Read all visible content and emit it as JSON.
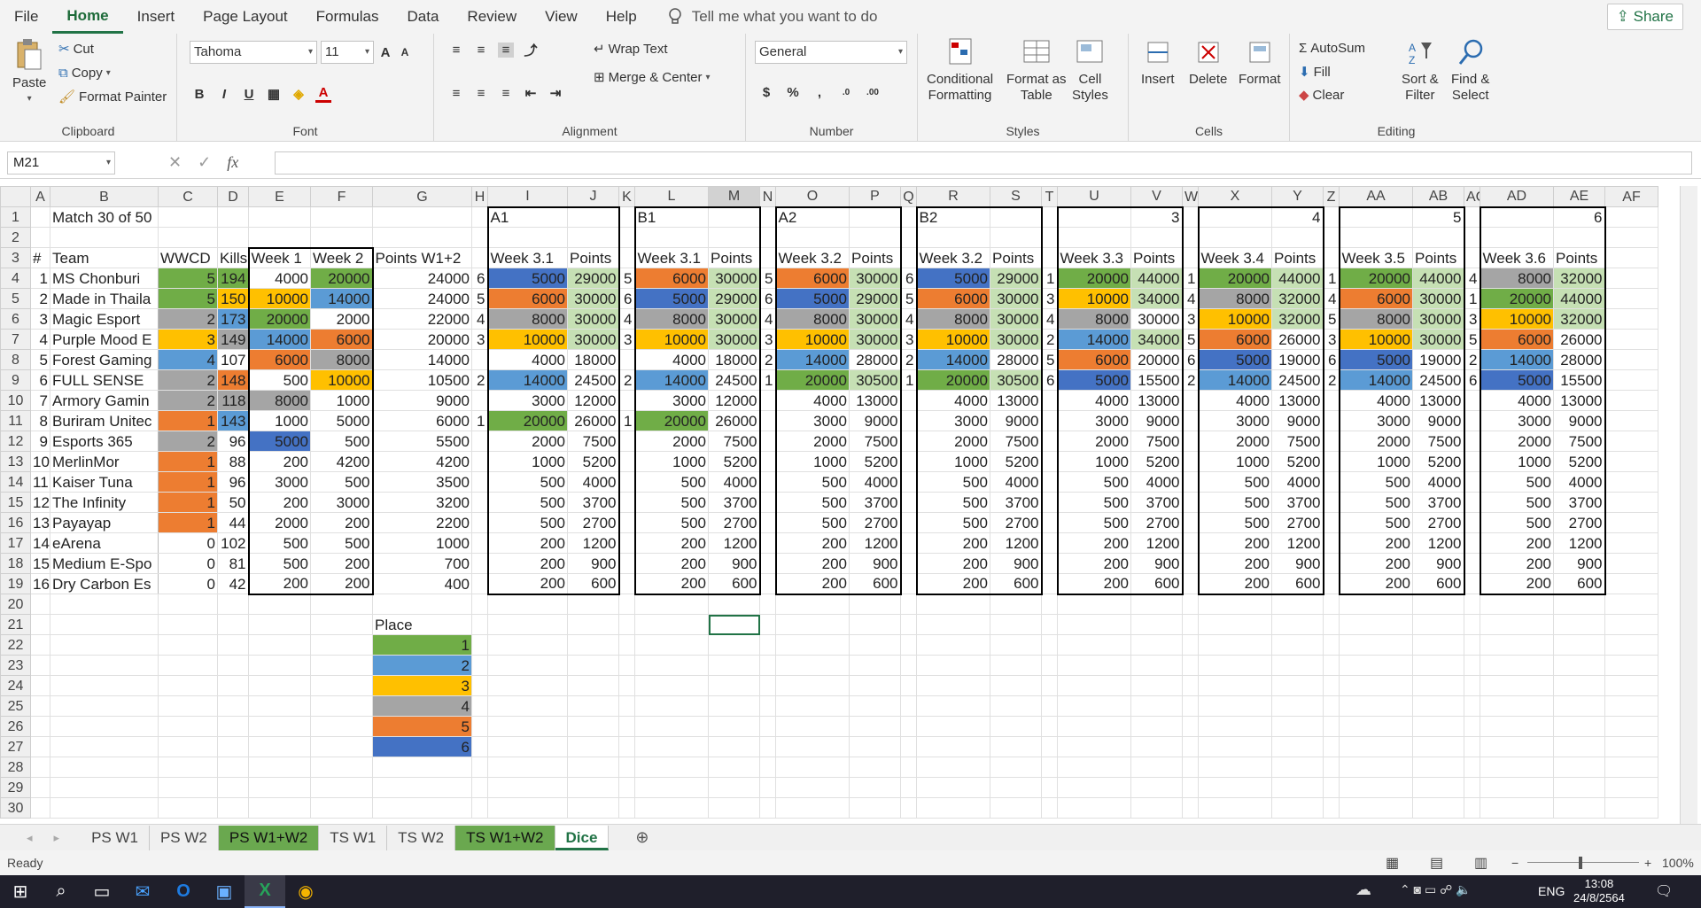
{
  "menu": {
    "tabs": [
      "File",
      "Home",
      "Insert",
      "Page Layout",
      "Formulas",
      "Data",
      "Review",
      "View",
      "Help"
    ],
    "active": "Home",
    "tellme": "Tell me what you want to do",
    "share": "Share"
  },
  "ribbon": {
    "clipboard": {
      "label": "Clipboard",
      "paste": "Paste",
      "cut": "Cut",
      "copy": "Copy",
      "format_painter": "Format Painter"
    },
    "font": {
      "label": "Font",
      "name": "Tahoma",
      "size": "11"
    },
    "alignment": {
      "label": "Alignment",
      "wrap": "Wrap Text",
      "merge": "Merge & Center"
    },
    "number": {
      "label": "Number",
      "format": "General"
    },
    "styles": {
      "label": "Styles",
      "cond": "Conditional",
      "cond2": "Formatting",
      "fmt_table": "Format as",
      "fmt_table2": "Table",
      "cell_styles": "Cell",
      "cell_styles2": "Styles"
    },
    "cells": {
      "label": "Cells",
      "insert": "Insert",
      "delete": "Delete",
      "format": "Format"
    },
    "editing": {
      "label": "Editing",
      "autosum": "AutoSum",
      "fill": "Fill",
      "clear": "Clear",
      "sort": "Sort &",
      "sort2": "Filter",
      "find": "Find &",
      "find2": "Select"
    }
  },
  "formula_bar": {
    "name_box": "M21",
    "fx": "fx",
    "content": ""
  },
  "columns": [
    "A",
    "B",
    "C",
    "D",
    "E",
    "F",
    "G",
    "H",
    "I",
    "J",
    "K",
    "L",
    "M",
    "N",
    "O",
    "P",
    "Q",
    "R",
    "S",
    "T",
    "U",
    "V",
    "W",
    "X",
    "Y",
    "Z",
    "AA",
    "AB",
    "AC",
    "AD",
    "AE",
    "AF"
  ],
  "place_colors": {
    "1": "#70ad47",
    "2": "#5b9bd5",
    "3": "#ffc000",
    "4": "#a5a5a5",
    "5": "#ed7d31",
    "6": "#4472c4",
    "light": "#c6e0b4"
  },
  "rows": [
    {
      "n": "1",
      "cells": {
        "B": "Match 30 of 50",
        "I": "A1",
        "L": "B1",
        "O": "A2",
        "R": "B2",
        "V": "3",
        "Y": "4",
        "AB": "5",
        "AE": "6"
      }
    },
    {
      "n": "2",
      "cells": {}
    },
    {
      "n": "3",
      "cells": {
        "A": "#",
        "B": "Team",
        "C": "WWCD",
        "D": "Kills",
        "E": "Week 1",
        "F": "Week 2",
        "G": "Points W1+2",
        "I": "Week 3.1",
        "J": "Points",
        "L": "Week 3.1",
        "M": "Points",
        "O": "Week 3.2",
        "P": "Points",
        "R": "Week 3.2",
        "S": "Points",
        "U": "Week 3.3",
        "V": "Points",
        "X": "Week 3.4",
        "Y": "Points",
        "AA": "Week 3.5",
        "AB": "Points",
        "AD": "Week 3.6",
        "AE": "Points"
      }
    },
    {
      "n": "4",
      "cells": {
        "A": "1",
        "B": "MS Chonburi",
        "C": "5",
        "D": "194",
        "E": "4000",
        "F": "20000",
        "G": "24000",
        "H": "6",
        "I": "5000",
        "J": "29000",
        "K": "5",
        "L": "6000",
        "M": "30000",
        "N": "5",
        "O": "6000",
        "P": "30000",
        "Q": "6",
        "R": "5000",
        "S": "29000",
        "T": "1",
        "U": "20000",
        "V": "44000",
        "W": "1",
        "X": "20000",
        "Y": "44000",
        "Z": "1",
        "AA": "20000",
        "AB": "44000",
        "AC": "4",
        "AD": "8000",
        "AE": "32000"
      }
    },
    {
      "n": "5",
      "cells": {
        "A": "2",
        "B": "Made in Thaila",
        "C": "5",
        "D": "150",
        "E": "10000",
        "F": "14000",
        "G": "24000",
        "H": "5",
        "I": "6000",
        "J": "30000",
        "K": "6",
        "L": "5000",
        "M": "29000",
        "N": "6",
        "O": "5000",
        "P": "29000",
        "Q": "5",
        "R": "6000",
        "S": "30000",
        "T": "3",
        "U": "10000",
        "V": "34000",
        "W": "4",
        "X": "8000",
        "Y": "32000",
        "Z": "4",
        "AA": "6000",
        "AB": "30000",
        "AC": "1",
        "AD": "20000",
        "AE": "44000"
      }
    },
    {
      "n": "6",
      "cells": {
        "A": "3",
        "B": "Magic Esport",
        "C": "2",
        "D": "173",
        "E": "20000",
        "F": "2000",
        "G": "22000",
        "H": "4",
        "I": "8000",
        "J": "30000",
        "K": "4",
        "L": "8000",
        "M": "30000",
        "N": "4",
        "O": "8000",
        "P": "30000",
        "Q": "4",
        "R": "8000",
        "S": "30000",
        "T": "4",
        "U": "8000",
        "V": "30000",
        "W": "3",
        "X": "10000",
        "Y": "32000",
        "Z": "5",
        "AA": "8000",
        "AB": "30000",
        "AC": "3",
        "AD": "10000",
        "AE": "32000"
      }
    },
    {
      "n": "7",
      "cells": {
        "A": "4",
        "B": "Purple Mood E",
        "C": "3",
        "D": "149",
        "E": "14000",
        "F": "6000",
        "G": "20000",
        "H": "3",
        "I": "10000",
        "J": "30000",
        "K": "3",
        "L": "10000",
        "M": "30000",
        "N": "3",
        "O": "10000",
        "P": "30000",
        "Q": "3",
        "R": "10000",
        "S": "30000",
        "T": "2",
        "U": "14000",
        "V": "34000",
        "W": "5",
        "X": "6000",
        "Y": "26000",
        "Z": "3",
        "AA": "10000",
        "AB": "30000",
        "AC": "5",
        "AD": "6000",
        "AE": "26000"
      }
    },
    {
      "n": "8",
      "cells": {
        "A": "5",
        "B": "Forest Gaming",
        "C": "4",
        "D": "107",
        "E": "6000",
        "F": "8000",
        "G": "14000",
        "I": "4000",
        "J": "18000",
        "L": "4000",
        "M": "18000",
        "N": "2",
        "O": "14000",
        "P": "28000",
        "Q": "2",
        "R": "14000",
        "S": "28000",
        "T": "5",
        "U": "6000",
        "V": "20000",
        "W": "6",
        "X": "5000",
        "Y": "19000",
        "Z": "6",
        "AA": "5000",
        "AB": "19000",
        "AC": "2",
        "AD": "14000",
        "AE": "28000"
      }
    },
    {
      "n": "9",
      "cells": {
        "A": "6",
        "B": "FULL SENSE",
        "C": "2",
        "D": "148",
        "E": "500",
        "F": "10000",
        "G": "10500",
        "H": "2",
        "I": "14000",
        "J": "24500",
        "K": "2",
        "L": "14000",
        "M": "24500",
        "N": "1",
        "O": "20000",
        "P": "30500",
        "Q": "1",
        "R": "20000",
        "S": "30500",
        "T": "6",
        "U": "5000",
        "V": "15500",
        "W": "2",
        "X": "14000",
        "Y": "24500",
        "Z": "2",
        "AA": "14000",
        "AB": "24500",
        "AC": "6",
        "AD": "5000",
        "AE": "15500"
      }
    },
    {
      "n": "10",
      "cells": {
        "A": "7",
        "B": "Armory Gamin",
        "C": "2",
        "D": "118",
        "E": "8000",
        "F": "1000",
        "G": "9000",
        "I": "3000",
        "J": "12000",
        "L": "3000",
        "M": "12000",
        "O": "4000",
        "P": "13000",
        "R": "4000",
        "S": "13000",
        "U": "4000",
        "V": "13000",
        "X": "4000",
        "Y": "13000",
        "AA": "4000",
        "AB": "13000",
        "AD": "4000",
        "AE": "13000"
      }
    },
    {
      "n": "11",
      "cells": {
        "A": "8",
        "B": "Buriram Unitec",
        "C": "1",
        "D": "143",
        "E": "1000",
        "F": "5000",
        "G": "6000",
        "H": "1",
        "I": "20000",
        "J": "26000",
        "K": "1",
        "L": "20000",
        "M": "26000",
        "O": "3000",
        "P": "9000",
        "R": "3000",
        "S": "9000",
        "U": "3000",
        "V": "9000",
        "X": "3000",
        "Y": "9000",
        "AA": "3000",
        "AB": "9000",
        "AD": "3000",
        "AE": "9000"
      }
    },
    {
      "n": "12",
      "cells": {
        "A": "9",
        "B": "Esports 365",
        "C": "2",
        "D": "96",
        "E": "5000",
        "F": "500",
        "G": "5500",
        "I": "2000",
        "J": "7500",
        "L": "2000",
        "M": "7500",
        "O": "2000",
        "P": "7500",
        "R": "2000",
        "S": "7500",
        "U": "2000",
        "V": "7500",
        "X": "2000",
        "Y": "7500",
        "AA": "2000",
        "AB": "7500",
        "AD": "2000",
        "AE": "7500"
      }
    },
    {
      "n": "13",
      "cells": {
        "A": "10",
        "B": "MerlinMor",
        "C": "1",
        "D": "88",
        "E": "200",
        "F": "4200",
        "G": "4200",
        "I": "1000",
        "J": "5200",
        "L": "1000",
        "M": "5200",
        "O": "1000",
        "P": "5200",
        "R": "1000",
        "S": "5200",
        "U": "1000",
        "V": "5200",
        "X": "1000",
        "Y": "5200",
        "AA": "1000",
        "AB": "5200",
        "AD": "1000",
        "AE": "5200"
      }
    },
    {
      "n": "14",
      "cells": {
        "A": "11",
        "B": "Kaiser Tuna",
        "C": "1",
        "D": "96",
        "E": "3000",
        "F": "500",
        "G": "3500",
        "I": "500",
        "J": "4000",
        "L": "500",
        "M": "4000",
        "O": "500",
        "P": "4000",
        "R": "500",
        "S": "4000",
        "U": "500",
        "V": "4000",
        "X": "500",
        "Y": "4000",
        "AA": "500",
        "AB": "4000",
        "AD": "500",
        "AE": "4000"
      }
    },
    {
      "n": "15",
      "cells": {
        "A": "12",
        "B": "The Infinity",
        "C": "1",
        "D": "50",
        "E": "200",
        "F": "3000",
        "G": "3200",
        "I": "500",
        "J": "3700",
        "L": "500",
        "M": "3700",
        "O": "500",
        "P": "3700",
        "R": "500",
        "S": "3700",
        "U": "500",
        "V": "3700",
        "X": "500",
        "Y": "3700",
        "AA": "500",
        "AB": "3700",
        "AD": "500",
        "AE": "3700"
      }
    },
    {
      "n": "16",
      "cells": {
        "A": "13",
        "B": "Payayap",
        "C": "1",
        "D": "44",
        "E": "2000",
        "F": "200",
        "G": "2200",
        "I": "500",
        "J": "2700",
        "L": "500",
        "M": "2700",
        "O": "500",
        "P": "2700",
        "R": "500",
        "S": "2700",
        "U": "500",
        "V": "2700",
        "X": "500",
        "Y": "2700",
        "AA": "500",
        "AB": "2700",
        "AD": "500",
        "AE": "2700"
      }
    },
    {
      "n": "17",
      "cells": {
        "A": "14",
        "B": "eArena",
        "C": "0",
        "D": "102",
        "E": "500",
        "F": "500",
        "G": "1000",
        "I": "200",
        "J": "1200",
        "L": "200",
        "M": "1200",
        "O": "200",
        "P": "1200",
        "R": "200",
        "S": "1200",
        "U": "200",
        "V": "1200",
        "X": "200",
        "Y": "1200",
        "AA": "200",
        "AB": "1200",
        "AD": "200",
        "AE": "1200"
      }
    },
    {
      "n": "18",
      "cells": {
        "A": "15",
        "B": "Medium E-Spo",
        "C": "0",
        "D": "81",
        "E": "500",
        "F": "200",
        "G": "700",
        "I": "200",
        "J": "900",
        "L": "200",
        "M": "900",
        "O": "200",
        "P": "900",
        "R": "200",
        "S": "900",
        "U": "200",
        "V": "900",
        "X": "200",
        "Y": "900",
        "AA": "200",
        "AB": "900",
        "AD": "200",
        "AE": "900"
      }
    },
    {
      "n": "19",
      "cells": {
        "A": "16",
        "B": "Dry Carbon Es",
        "C": "0",
        "D": "42",
        "E": "200",
        "F": "200",
        "G": "400",
        "I": "200",
        "J": "600",
        "L": "200",
        "M": "600",
        "O": "200",
        "P": "600",
        "R": "200",
        "S": "600",
        "U": "200",
        "V": "600",
        "X": "200",
        "Y": "600",
        "AA": "200",
        "AB": "600",
        "AD": "200",
        "AE": "600"
      }
    },
    {
      "n": "20",
      "cells": {}
    },
    {
      "n": "21",
      "cells": {
        "G": "Place"
      }
    },
    {
      "n": "22",
      "cells": {
        "G": "1"
      }
    },
    {
      "n": "23",
      "cells": {
        "G": "2"
      }
    },
    {
      "n": "24",
      "cells": {
        "G": "3"
      }
    },
    {
      "n": "25",
      "cells": {
        "G": "4"
      }
    },
    {
      "n": "26",
      "cells": {
        "G": "5"
      }
    },
    {
      "n": "27",
      "cells": {
        "G": "6"
      }
    },
    {
      "n": "28",
      "cells": {}
    },
    {
      "n": "29",
      "cells": {}
    },
    {
      "n": "30",
      "cells": {}
    }
  ],
  "fills": {
    "C4": "1",
    "D4": "1",
    "F4": "1",
    "I4": "6",
    "J4": "light",
    "L4": "5",
    "M4": "light",
    "O4": "5",
    "P4": "light",
    "R4": "6",
    "S4": "light",
    "U4": "1",
    "V4": "light",
    "X4": "1",
    "Y4": "light",
    "AA4": "1",
    "AB4": "light",
    "AD4": "4",
    "AE4": "light",
    "C5": "1",
    "D5": "3",
    "E5": "3",
    "F5": "2",
    "I5": "5",
    "J5": "light",
    "L5": "6",
    "M5": "light",
    "O5": "6",
    "P5": "light",
    "R5": "5",
    "S5": "light",
    "U5": "3",
    "V5": "light",
    "X5": "4",
    "Y5": "light",
    "AA5": "5",
    "AB5": "light",
    "AD5": "1",
    "AE5": "light",
    "C6": "4",
    "D6": "2",
    "E6": "1",
    "I6": "4",
    "J6": "light",
    "L6": "4",
    "M6": "light",
    "O6": "4",
    "P6": "light",
    "R6": "4",
    "S6": "light",
    "U6": "4",
    "X6": "3",
    "Y6": "light",
    "AA6": "4",
    "AB6": "light",
    "AD6": "3",
    "AE6": "light",
    "C7": "3",
    "D7": "4",
    "E7": "2",
    "F7": "5",
    "I7": "3",
    "J7": "light",
    "L7": "3",
    "M7": "light",
    "O7": "3",
    "P7": "light",
    "R7": "3",
    "S7": "light",
    "U7": "2",
    "V7": "light",
    "X7": "5",
    "AA7": "3",
    "AB7": "light",
    "AD7": "5",
    "C8": "2",
    "E8": "5",
    "F8": "4",
    "O8": "2",
    "R8": "2",
    "U8": "5",
    "X8": "6",
    "AA8": "6",
    "AD8": "2",
    "C9": "4",
    "D9": "5",
    "F9": "3",
    "I9": "2",
    "L9": "2",
    "O9": "1",
    "P9": "light",
    "R9": "1",
    "S9": "light",
    "U9": "6",
    "X9": "2",
    "AA9": "2",
    "AD9": "6",
    "C10": "4",
    "D10": "4",
    "E10": "4",
    "C11": "5",
    "D11": "2",
    "I11": "1",
    "L11": "1",
    "C12": "4",
    "E12": "6",
    "C13": "5",
    "C14": "5",
    "C15": "5",
    "C16": "5",
    "G22": "1",
    "G23": "2",
    "G24": "3",
    "G25": "4",
    "G26": "5",
    "G27": "6"
  },
  "sheet_tabs": [
    {
      "label": "PS W1",
      "style": ""
    },
    {
      "label": "PS W2",
      "style": ""
    },
    {
      "label": "PS W1+W2",
      "style": "green"
    },
    {
      "label": "TS W1",
      "style": ""
    },
    {
      "label": "TS W2",
      "style": ""
    },
    {
      "label": "TS W1+W2",
      "style": "green"
    },
    {
      "label": "Dice",
      "style": "active"
    }
  ],
  "status": {
    "ready": "Ready",
    "zoom": "100%"
  },
  "taskbar": {
    "lang": "ENG",
    "time": "13:08",
    "date": "24/8/2564"
  }
}
